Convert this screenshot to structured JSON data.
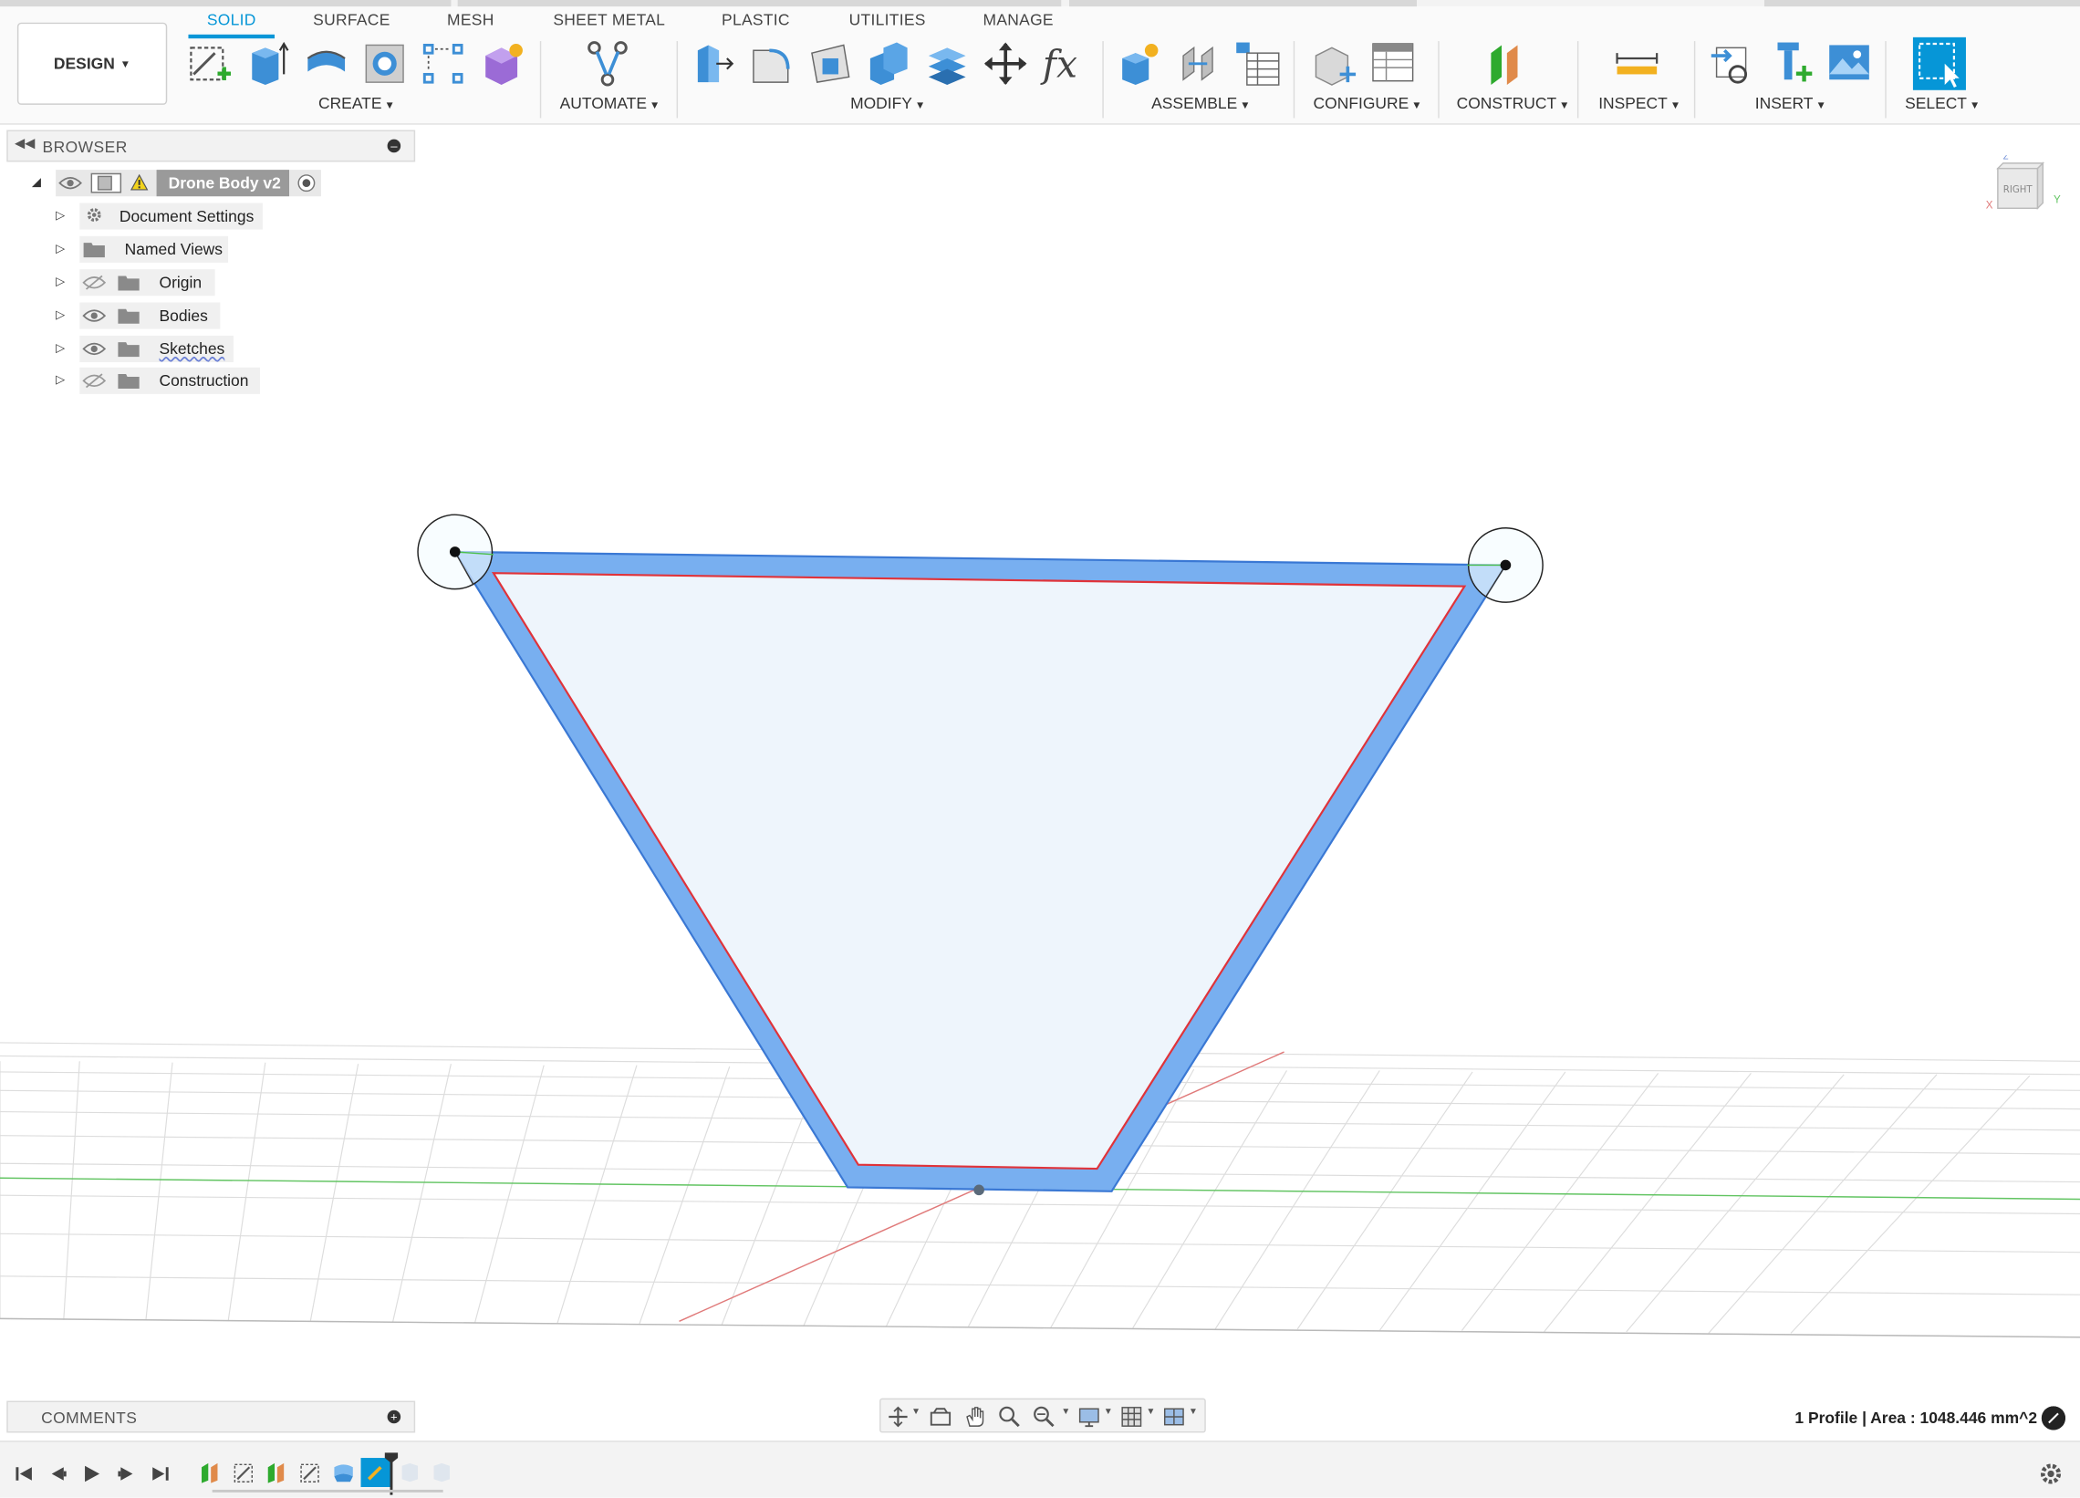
{
  "toolbar": {
    "mode_label": "DESIGN",
    "tabs": [
      "SOLID",
      "SURFACE",
      "MESH",
      "SHEET METAL",
      "PLASTIC",
      "UTILITIES",
      "MANAGE"
    ],
    "active_tab": "SOLID",
    "groups": {
      "create": "CREATE",
      "automate": "AUTOMATE",
      "modify": "MODIFY",
      "assemble": "ASSEMBLE",
      "configure": "CONFIGURE",
      "construct": "CONSTRUCT",
      "inspect": "INSPECT",
      "insert": "INSERT",
      "select": "SELECT"
    },
    "accent_color": "#0696d7"
  },
  "browser": {
    "title": "BROWSER",
    "root": "Drone Body v2",
    "items": [
      {
        "label": "Document Settings",
        "icon": "gear-icon"
      },
      {
        "label": "Named Views",
        "icon": "folder-icon"
      },
      {
        "label": "Origin",
        "icon": "folder-icon",
        "visibility": "hidden"
      },
      {
        "label": "Bodies",
        "icon": "folder-icon",
        "visibility": "visible"
      },
      {
        "label": "Sketches",
        "icon": "folder-icon",
        "visibility": "visible"
      },
      {
        "label": "Construction",
        "icon": "folder-icon",
        "visibility": "hidden"
      }
    ]
  },
  "viewcube": {
    "face": "RIGHT",
    "axis_z": "Z",
    "axis_x": "X",
    "axis_y": "Y"
  },
  "comments": {
    "title": "COMMENTS"
  },
  "status": {
    "text": "1 Profile | Area : 1048.446 mm^2"
  }
}
